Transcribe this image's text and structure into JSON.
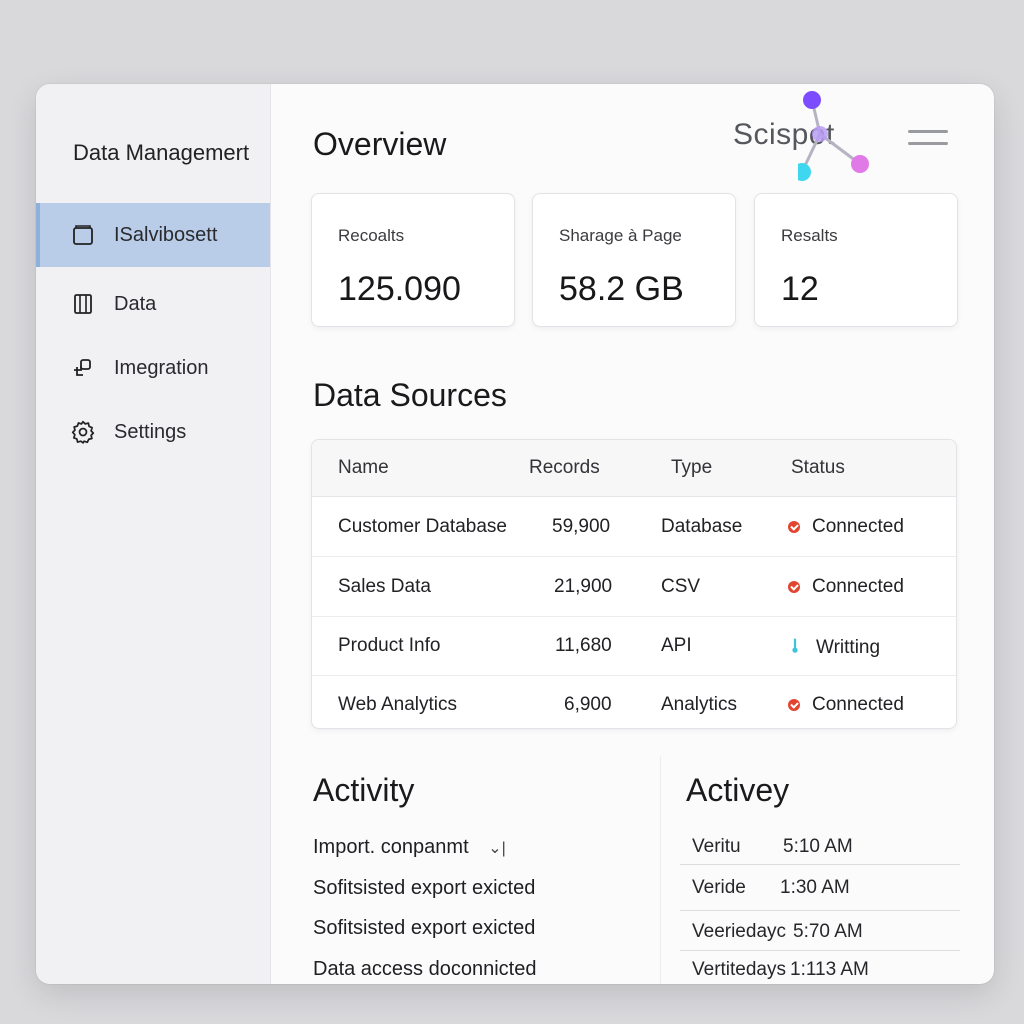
{
  "app": {
    "title": "Data Managemert"
  },
  "sidebar": {
    "items": [
      {
        "label": "ISalvibosett",
        "icon": "folder-icon",
        "active": true
      },
      {
        "label": "Data",
        "icon": "database-icon",
        "active": false
      },
      {
        "label": "Imegration",
        "icon": "integration-icon",
        "active": false
      },
      {
        "label": "Settings",
        "icon": "gear-icon",
        "active": false
      }
    ]
  },
  "header": {
    "title": "Overview",
    "logo_text": "Scispot"
  },
  "colors": {
    "accent": "#b9cde8",
    "connected": "#e2452f",
    "writing": "#3fc3dc",
    "logo_purple": "#7c4dff",
    "logo_cyan": "#3fd7f0",
    "logo_pink": "#e07ae6"
  },
  "stats": [
    {
      "label": "Recoalts",
      "value": "125.090"
    },
    {
      "label": "Sharage à Page",
      "value": "58.2 GB"
    },
    {
      "label": "Resalts",
      "value": "12"
    }
  ],
  "sources": {
    "title": "Data Sources",
    "columns": [
      "Name",
      "Records",
      "Type",
      "Status"
    ],
    "rows": [
      {
        "name": "Customer Database",
        "records": "59,900",
        "type": "Database",
        "status": "Connected",
        "status_icon": "check-circle-icon"
      },
      {
        "name": "Sales Data",
        "records": "21,900",
        "type": "CSV",
        "status": "Connected",
        "status_icon": "check-circle-icon"
      },
      {
        "name": "Product Info",
        "records": "11,680",
        "type": "API",
        "status": "Writting",
        "status_icon": "thermometer-icon"
      },
      {
        "name": "Web Analytics",
        "records": "6,900",
        "type": "Analytics",
        "status": "Connected",
        "status_icon": "check-circle-icon"
      }
    ]
  },
  "activity": {
    "title": "Activity",
    "items": [
      "Import. conpanmt",
      "Sofitsisted export exicted",
      "Sofitsisted export exicted",
      "Data access doconnicted"
    ],
    "dropdown_glyph": "⌄|"
  },
  "activey": {
    "title": "Activey",
    "rows": [
      {
        "label": "Veritu",
        "time": "5:10 AM"
      },
      {
        "label": "Veride",
        "time": "1:30 AM"
      },
      {
        "label": "Veeriedayc",
        "time": "5:70 AM"
      },
      {
        "label": "Vertitedays",
        "time": "1:113 AM"
      }
    ]
  }
}
